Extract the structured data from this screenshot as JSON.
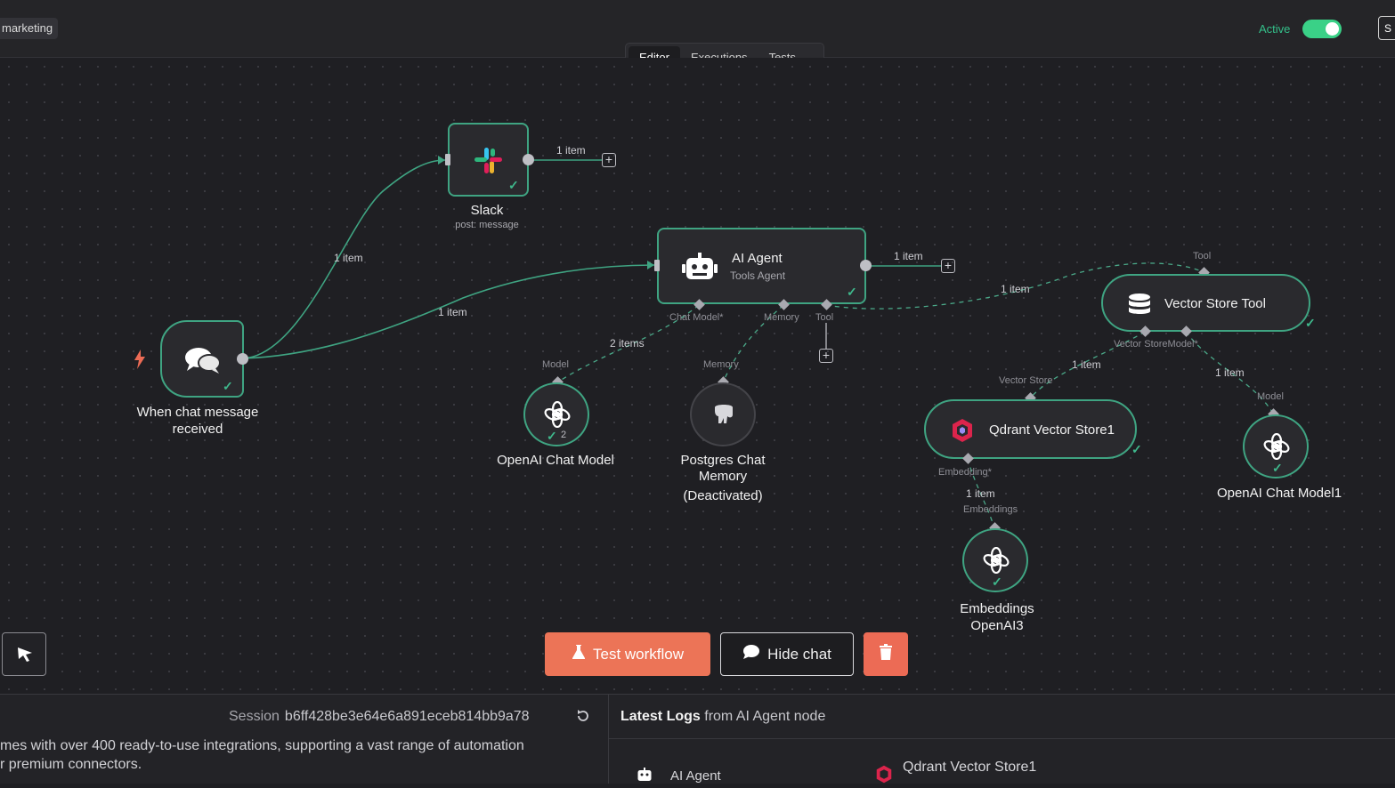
{
  "header": {
    "workflow_tag": "marketing",
    "active_label": "Active",
    "save_label": "S",
    "tabs": [
      {
        "label": "Editor",
        "active": true
      },
      {
        "label": "Executions",
        "active": false
      },
      {
        "label": "Tests",
        "active": false
      }
    ]
  },
  "nodes": {
    "trigger": {
      "title": "When chat message received",
      "icon": "chat-bubbles-icon"
    },
    "slack": {
      "title": "Slack",
      "subtitle": "post: message",
      "icon": "slack-icon"
    },
    "agent": {
      "title": "AI Agent",
      "subtitle": "Tools Agent",
      "icon": "robot-icon",
      "ports": [
        "Chat Model*",
        "Memory",
        "Tool"
      ]
    },
    "openai_chat": {
      "title": "OpenAI Chat Model",
      "port": "Model",
      "run_count": "2",
      "icon": "openai-icon"
    },
    "postgres": {
      "title_line1": "Postgres Chat",
      "title_line2": "Memory",
      "title_line3": "(Deactivated)",
      "port": "Memory",
      "icon": "elephant-icon"
    },
    "vector_tool": {
      "title": "Vector Store Tool",
      "port_top": "Tool",
      "port_bottom": "Vector StoreModel*",
      "icon": "database-icon"
    },
    "qdrant": {
      "title": "Qdrant Vector Store1",
      "port_top": "Vector Store",
      "port_bottom": "Embedding*",
      "icon": "qdrant-icon"
    },
    "openai_chat1": {
      "title": "OpenAI Chat Model1",
      "port": "Model",
      "icon": "openai-icon"
    },
    "embeddings": {
      "title_line1": "Embeddings",
      "title_line2": "OpenAI3",
      "port": "Embeddings",
      "icon": "openai-icon"
    }
  },
  "edge_labels": {
    "trigger_slack": "1 item",
    "trigger_agent": "1 item",
    "slack_out": "1 item",
    "agent_out": "1 item",
    "agent_model": "2 items",
    "agent_tool": "1 item",
    "tool_qdrant": "1 item",
    "tool_model": "1 item",
    "qdrant_emb": "1 item"
  },
  "actions": {
    "test_workflow": "Test workflow",
    "hide_chat": "Hide chat"
  },
  "chat": {
    "session_label": "Session",
    "session_id": "b6ff428be3e64e6a891eceb814bb9a78",
    "message_line1": "mes with over 400 ready-to-use integrations, supporting a vast range of automation",
    "message_line2": "r premium connectors."
  },
  "logs": {
    "heading_bold": "Latest Logs",
    "heading_rest": " from AI Agent node",
    "items": [
      "AI Agent",
      "Qdrant Vector Store1"
    ]
  },
  "colors": {
    "accent_green": "#3fa482",
    "test_button": "#ec7457",
    "toggle_on": "#3ad187"
  }
}
